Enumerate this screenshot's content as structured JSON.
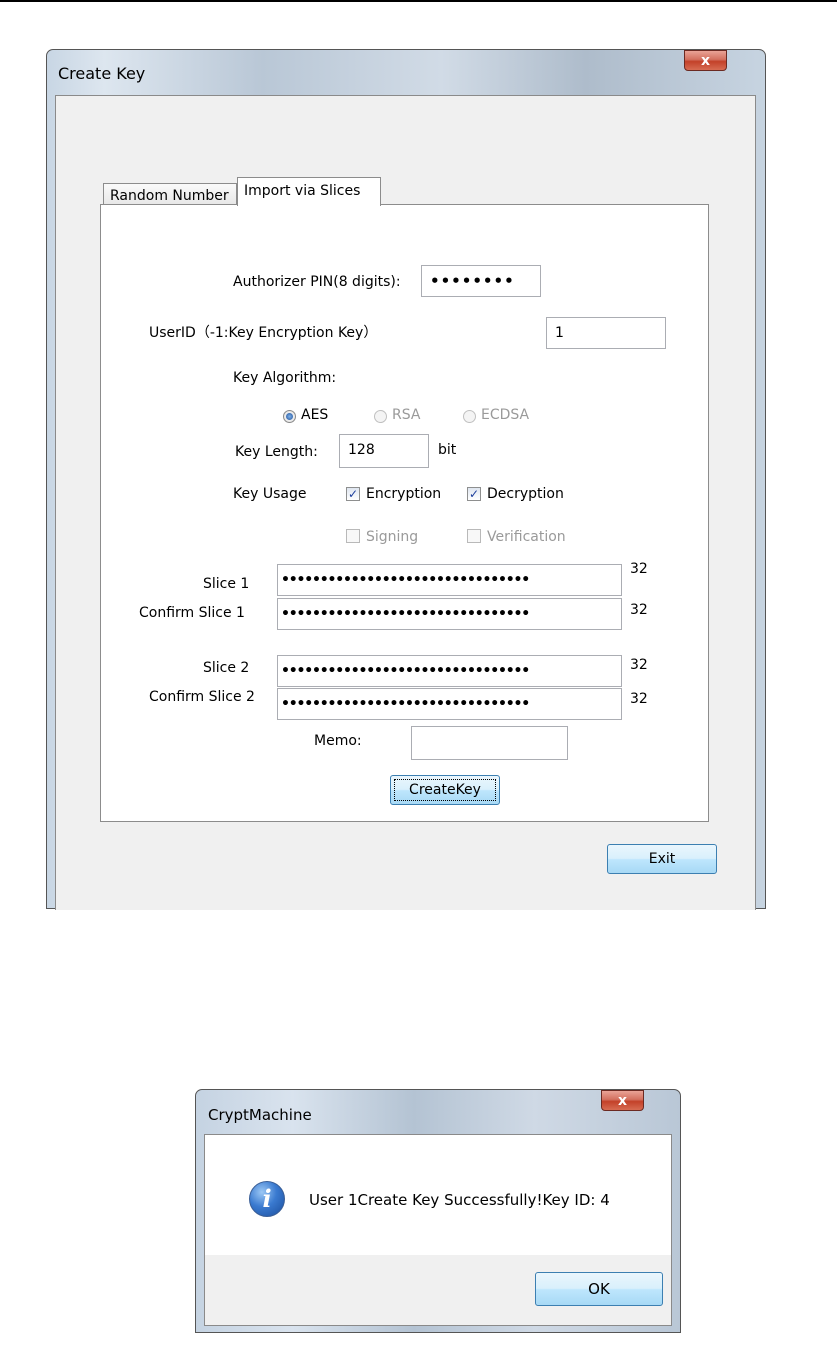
{
  "create_key_window": {
    "title": "Create Key",
    "close_glyph": "x",
    "tabs": [
      {
        "label": "Random Number",
        "active": false
      },
      {
        "label": "Import via Slices",
        "active": true
      }
    ],
    "form": {
      "authorizer_pin_label": "Authorizer PIN(8 digits):",
      "authorizer_pin_value": "••••••••",
      "userid_label": "UserID（-1:Key Encryption Key）",
      "userid_value": "1",
      "key_algorithm_label": "Key Algorithm:",
      "algorithms": [
        {
          "label": "AES",
          "selected": true,
          "enabled": true
        },
        {
          "label": "RSA",
          "selected": false,
          "enabled": false
        },
        {
          "label": "ECDSA",
          "selected": false,
          "enabled": false
        }
      ],
      "key_length_label": "Key Length:",
      "key_length_value": "128",
      "key_length_unit": "bit",
      "key_usage_label": "Key Usage",
      "usages": [
        {
          "label": "Encryption",
          "checked": true,
          "enabled": true
        },
        {
          "label": "Decryption",
          "checked": true,
          "enabled": true
        },
        {
          "label": "Signing",
          "checked": false,
          "enabled": false
        },
        {
          "label": "Verification",
          "checked": false,
          "enabled": false
        }
      ],
      "slices": [
        {
          "label": "Slice 1",
          "value": "••••••••••••••••••••••••••••••••",
          "count": "32"
        },
        {
          "label": "Confirm Slice 1",
          "value": "••••••••••••••••••••••••••••••••",
          "count": "32"
        },
        {
          "label": "Slice 2",
          "value": "••••••••••••••••••••••••••••••••",
          "count": "32"
        },
        {
          "label": "Confirm Slice 2",
          "value": "••••••••••••••••••••••••••••••••",
          "count": "32"
        }
      ],
      "memo_label": "Memo:",
      "memo_value": "",
      "create_button": "CreateKey"
    },
    "exit_button": "Exit"
  },
  "message_dialog": {
    "title": "CryptMachine",
    "close_glyph": "x",
    "icon": "info-icon",
    "icon_glyph": "i",
    "message": "User 1Create Key Successfully!Key ID: 4",
    "ok_button": "OK"
  }
}
